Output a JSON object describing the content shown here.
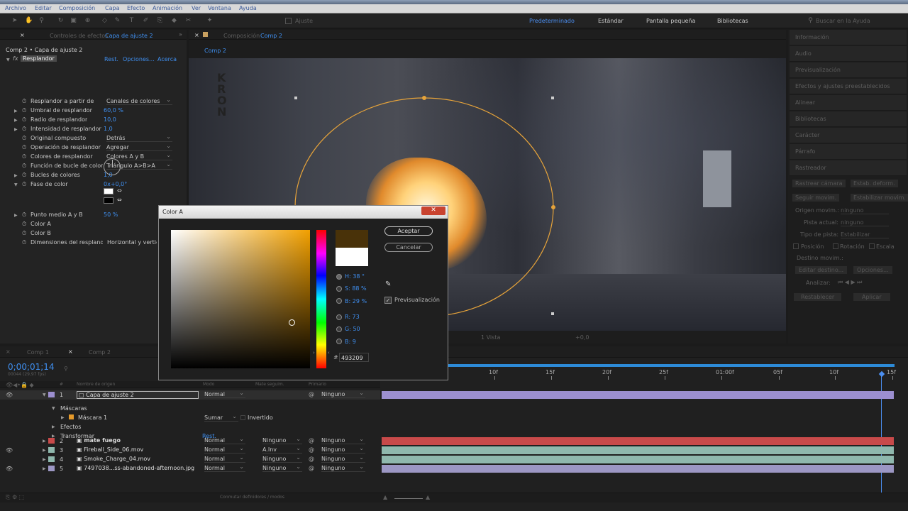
{
  "menu": [
    "Archivo",
    "Editar",
    "Composición",
    "Capa",
    "Efecto",
    "Animación",
    "Ver",
    "Ventana",
    "Ayuda"
  ],
  "toolbar": {
    "ajuste": "Ajuste",
    "workspaces": [
      "Predeterminado",
      "Estándar",
      "Pantalla pequeña",
      "Bibliotecas"
    ],
    "search_placeholder": "Buscar en la Ayuda"
  },
  "effects_panel": {
    "tab_prefix": "Controles de efectos",
    "tab_layer": "Capa de ajuste 2",
    "subtitle": "Comp 2 • Capa de ajuste 2",
    "effect_name": "Resplandor",
    "links": [
      "Rest.",
      "Opciones...",
      "Acerca"
    ],
    "props": [
      {
        "label": "Resplandor a partir de",
        "value": "Canales de colores"
      },
      {
        "label": "Umbral de resplandor",
        "value": "60,0 %"
      },
      {
        "label": "Radio de resplandor",
        "value": "10,0"
      },
      {
        "label": "Intensidad de resplandor",
        "value": "1,0"
      },
      {
        "label": "Original compuesto",
        "value": "Detrás"
      },
      {
        "label": "Operación de resplandor",
        "value": "Agregar"
      },
      {
        "label": "Colores de resplandor",
        "value": "Colores A y B"
      },
      {
        "label": "Función de bucle de color",
        "value": "Triángulo A>B>A"
      },
      {
        "label": "Bucles de colores",
        "value": "1,0"
      },
      {
        "label": "Fase de color",
        "value": "0x+0,0°"
      },
      {
        "label": "Punto medio A y B",
        "value": "50 %"
      },
      {
        "label": "Color A",
        "value": ""
      },
      {
        "label": "Color B",
        "value": ""
      },
      {
        "label": "Dimensiones del resplandor",
        "value": "Horizontal y vertical"
      }
    ]
  },
  "comp_panel": {
    "tab_prefix": "Composición",
    "tab_name": "Comp 2",
    "breadcrumb": "Comp 2",
    "footer": [
      "1 Vista",
      "+0,0"
    ]
  },
  "right_panels": [
    "Información",
    "Audio",
    "Previsualización",
    "Efectos y ajustes preestablecidos",
    "Alinear",
    "Bibliotecas",
    "Carácter",
    "Párrafo",
    "Rastreador"
  ],
  "tracker": {
    "buttons1": [
      "Rastrear cámara",
      "Estab. deform."
    ],
    "buttons2": [
      "Seguir movim.",
      "Estabilizar movim."
    ],
    "origen_label": "Origen movim.:",
    "origen_value": "ninguno",
    "pista_label": "Pista actual:",
    "pista_value": "ninguno",
    "tipo_label": "Tipo de pista:",
    "tipo_value": "Estabilizar",
    "checks": [
      "Posición",
      "Rotación",
      "Escala"
    ],
    "destino": "Destino movim.:",
    "btn_editar": "Editar destino...",
    "btn_opciones": "Opciones...",
    "analizar": "Analizar:",
    "btn_rest": "Restablecer",
    "btn_aplicar": "Aplicar"
  },
  "dialog": {
    "title": "Color A",
    "ok": "Aceptar",
    "cancel": "Cancelar",
    "preview": "Previsualización",
    "H": "H: 38 °",
    "S": "S: 88 %",
    "B": "B: 29 %",
    "R": "R: 73",
    "G": "G: 50",
    "Bv": "B: 9",
    "hex_label": "#",
    "hex": "493209",
    "old_color": "#ffffff",
    "new_color": "#493209"
  },
  "timeline": {
    "tabs": [
      "Comp 1",
      "Comp 2"
    ],
    "timecode": "0;00;01;14",
    "fps": "00044 (29,97 fps)",
    "headers": [
      "#",
      "Nombre de origen",
      "Modo",
      "Mate seguim.",
      "Primario"
    ],
    "ruler": [
      "10f",
      "15f",
      "20f",
      "25f",
      "01:00f",
      "05f",
      "10f",
      "15f"
    ],
    "layers": [
      {
        "num": "1",
        "name": "Capa de ajuste 2",
        "mode": "Normal",
        "trk": "",
        "parent": "Ninguno",
        "color": "#9c8fd0"
      },
      {
        "num": "2",
        "name": "mate fuego",
        "mode": "Normal",
        "trk": "Ninguno",
        "parent": "Ninguno",
        "color": "#c84a4a"
      },
      {
        "num": "3",
        "name": "Fireball_Side_06.mov",
        "mode": "Normal",
        "trk": "A.Inv",
        "parent": "Ninguno",
        "color": "#8fb8ad"
      },
      {
        "num": "4",
        "name": "Smoke_Charge_04.mov",
        "mode": "Normal",
        "trk": "Ninguno",
        "parent": "Ninguno",
        "color": "#8fb8ad"
      },
      {
        "num": "5",
        "name": "7497038...ss-abandoned-afternoon.jpg",
        "mode": "Normal",
        "trk": "Ninguno",
        "parent": "Ninguno",
        "color": "#9c97c4"
      }
    ],
    "masks": "Máscaras",
    "mask1": "Máscara 1",
    "mask_mode": "Sumar",
    "mask_inv": "Invertido",
    "effects": "Efectos",
    "transform": "Transformar",
    "rest": "Rest.",
    "footer": "Conmutar definidores / modos"
  },
  "colors": {
    "accent": "#3f8ff0",
    "work_area": "#2d8bd8"
  }
}
